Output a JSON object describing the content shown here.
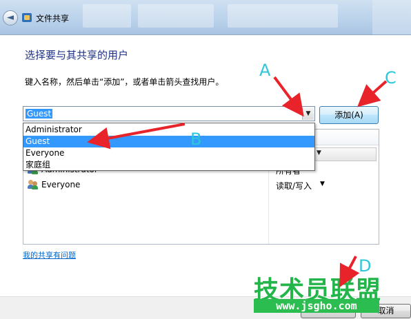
{
  "window": {
    "title": "文件共享"
  },
  "main": {
    "heading": "选择要与其共享的用户",
    "instruction": "键入名称，然后单击“添加”，或者单击箭头查找用户。",
    "combo_value": "Guest",
    "add_button": "添加(A)",
    "dropdown_items": [
      "Administrator",
      "Guest",
      "Everyone",
      "家庭组"
    ],
    "selected_item": "Guest",
    "users": [
      {
        "name": "Administrator",
        "permission": "所有者"
      },
      {
        "name": "Everyone",
        "permission": "读取/写入"
      }
    ],
    "help_link": "我的共享有问题"
  },
  "footer": {
    "cancel_button": "取消"
  },
  "annotations": {
    "a": "A",
    "b": "B",
    "c": "C",
    "d": "D"
  },
  "watermark": {
    "text": "技术员联盟",
    "url": "www.jsgho.com"
  },
  "colors": {
    "annotation_arrow": "#e8242a",
    "annotation_letter": "#2ec7d9",
    "selection": "#3399ff",
    "heading": "#1e3287",
    "watermark": "#23b54a"
  }
}
